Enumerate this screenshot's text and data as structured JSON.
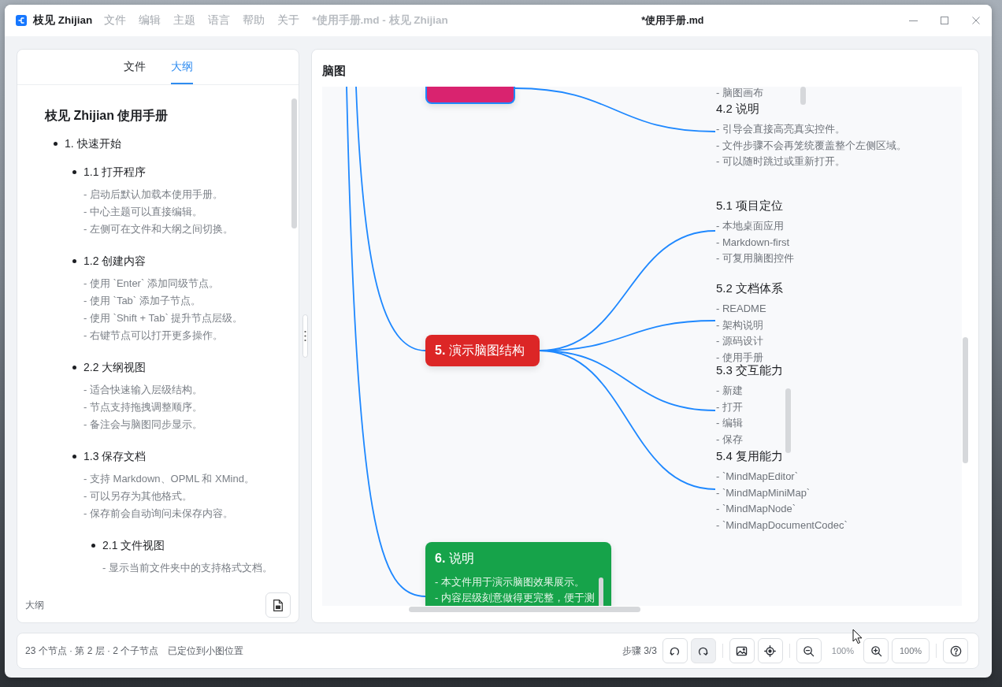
{
  "window": {
    "app_name": "枝见 Zhijian",
    "menu": [
      "文件",
      "编辑",
      "主题",
      "语言",
      "帮助",
      "关于"
    ],
    "document_title": "*使用手册.md - 枝见 Zhijian",
    "title": "*使用手册.md"
  },
  "sidebar": {
    "tabs": [
      {
        "label": "文件",
        "selected": false
      },
      {
        "label": "大纲",
        "selected": true
      }
    ],
    "outline": {
      "title": "枝见 Zhijian 使用手册",
      "items": [
        {
          "label": "1. 快速开始",
          "children": [
            {
              "label": "1.1 打开程序",
              "notes": [
                "- 启动后默认加载本使用手册。",
                "- 中心主题可以直接编辑。",
                "- 左侧可在文件和大纲之间切换。"
              ]
            },
            {
              "label": "1.2 创建内容",
              "notes": [
                "- 使用 `Enter` 添加同级节点。",
                "- 使用 `Tab` 添加子节点。",
                "- 使用 `Shift + Tab` 提升节点层级。",
                "- 右键节点可以打开更多操作。"
              ]
            },
            {
              "label": "2.2 大纲视图",
              "notes": [
                "- 适合快速输入层级结构。",
                "- 节点支持拖拽调整顺序。",
                "- 备注会与脑图同步显示。"
              ]
            },
            {
              "label": "1.3 保存文档",
              "notes": [
                "- 支持 Markdown、OPML 和 XMind。",
                "- 可以另存为其他格式。",
                "- 保存前会自动询问未保存内容。"
              ],
              "children": [
                {
                  "label": "2.1 文件视图",
                  "notes": [
                    "- 显示当前文件夹中的支持格式文档。"
                  ]
                }
              ]
            }
          ]
        }
      ]
    },
    "footer_label": "大纲"
  },
  "mindmap": {
    "title": "脑图",
    "branches": [
      {
        "selected": true,
        "color": "#d9236f",
        "topics": [
          {
            "notes": [
              "- 脑图画布"
            ]
          },
          {
            "title": "4.2 说明",
            "notes": [
              "- 引导会直接高亮真实控件。",
              "- 文件步骤不会再笼统覆盖整个左侧区域。",
              "- 可以随时跳过或重新打开。"
            ]
          }
        ]
      },
      {
        "title": "**5.** 演示脑图结构",
        "selected": false,
        "color": "#dc2626",
        "topics": [
          {
            "title": "5.1 项目定位",
            "notes": [
              "- 本地桌面应用",
              "- Markdown-first",
              "- 可复用脑图控件"
            ]
          },
          {
            "title": "5.2 文档体系",
            "notes": [
              "- README",
              "- 架构说明",
              "- 源码设计",
              "- 使用手册"
            ]
          },
          {
            "title": "5.3 交互能力",
            "notes": [
              "- 新建",
              "- 打开",
              "- 编辑",
              "- 保存"
            ]
          },
          {
            "title": "5.4 复用能力",
            "notes": [
              "- `MindMapEditor`",
              "- `MindMapMiniMap`",
              "- `MindMapNode`",
              "- `MindMapDocumentCodec`"
            ]
          }
        ]
      },
      {
        "title": "**6.** 说明",
        "selected": false,
        "color": "#16a34a",
        "notes": [
          "- 本文件用于演示脑图效果展示。",
          "- 内容层级刻意做得更完整，便于测"
        ]
      }
    ]
  },
  "status_bar": {
    "info": "23 个节点 · 第 2 层 · 2 个子节点",
    "message": "已定位到小图位置",
    "step": "步骤 3/3",
    "tool_groups": [
      [
        {
          "kind": "undo",
          "disabled": false
        },
        {
          "kind": "redo",
          "disabled": true
        }
      ],
      [
        {
          "kind": "image",
          "disabled": false
        },
        {
          "kind": "locate",
          "disabled": false
        }
      ],
      [
        {
          "kind": "zoom-out",
          "disabled": false
        },
        {
          "kind": "reading",
          "text": "100%"
        },
        {
          "kind": "zoom-in",
          "disabled": false
        },
        {
          "kind": "text-button",
          "text": "100%",
          "disabled": false
        }
      ],
      [
        {
          "kind": "help",
          "disabled": false
        }
      ]
    ]
  }
}
